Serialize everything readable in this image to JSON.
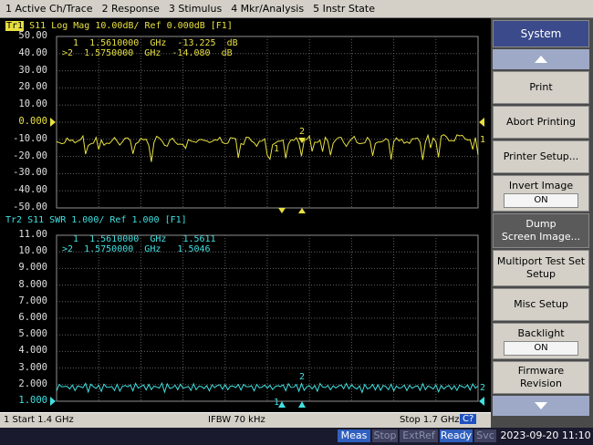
{
  "menubar": [
    "1 Active Ch/Trace",
    "2 Response",
    "3 Stimulus",
    "4 Mkr/Analysis",
    "5 Instr State"
  ],
  "trace1": {
    "tag": "Tr1",
    "header": "S11 Log Mag 10.00dB/ Ref 0.000dB [F1]",
    "color": "#e8e040",
    "yticks": [
      "50.00",
      "40.00",
      "30.00",
      "20.00",
      "10.00",
      "0.000",
      "-10.00",
      "-20.00",
      "-30.00",
      "-40.00",
      "-50.00"
    ],
    "markers": [
      {
        "line": "  1  1.5610000  GHz  -13.225  dB"
      },
      {
        "line": ">2  1.5750000  GHz  -14.080  dB"
      }
    ],
    "marker_labels": [
      "1",
      "2"
    ],
    "right_label": "1"
  },
  "trace2": {
    "header": "Tr2  S11  SWR 1.000/ Ref 1.000 [F1]",
    "color": "#40e0e0",
    "yticks": [
      "11.00",
      "10.00",
      "9.000",
      "8.000",
      "7.000",
      "6.000",
      "5.000",
      "4.000",
      "3.000",
      "2.000",
      "1.000"
    ],
    "markers": [
      {
        "line": "  1  1.5610000  GHz   1.5611"
      },
      {
        "line": ">2  1.5750000  GHz   1.5046"
      }
    ],
    "marker_labels": [
      "1",
      "2"
    ],
    "right_label": "2"
  },
  "status": {
    "start": "1  Start 1.4 GHz",
    "ifbw": "IFBW 70 kHz",
    "stop": "Stop 1.7 GHz",
    "cal": "C?"
  },
  "bottom": {
    "meas": "Meas",
    "stop": "Stop",
    "extref": "ExtRef",
    "ready": "Ready",
    "svc": "Svc",
    "datetime": "2023-09-20 11:10"
  },
  "softkeys": {
    "title": "System",
    "print": "Print",
    "abort": "Abort Printing",
    "printer_setup": "Printer Setup...",
    "invert_label": "Invert Image",
    "invert_value": "ON",
    "dump1": "Dump",
    "dump2": "Screen Image...",
    "multiport1": "Multiport Test Set",
    "multiport2": "Setup",
    "misc": "Misc Setup",
    "backlight_label": "Backlight",
    "backlight_value": "ON",
    "firmware1": "Firmware",
    "firmware2": "Revision"
  },
  "colors": {
    "grid": "#808080",
    "accent": "#e8e040",
    "swr": "#40e0e0",
    "softkey_title": "#3a4a8a"
  }
}
